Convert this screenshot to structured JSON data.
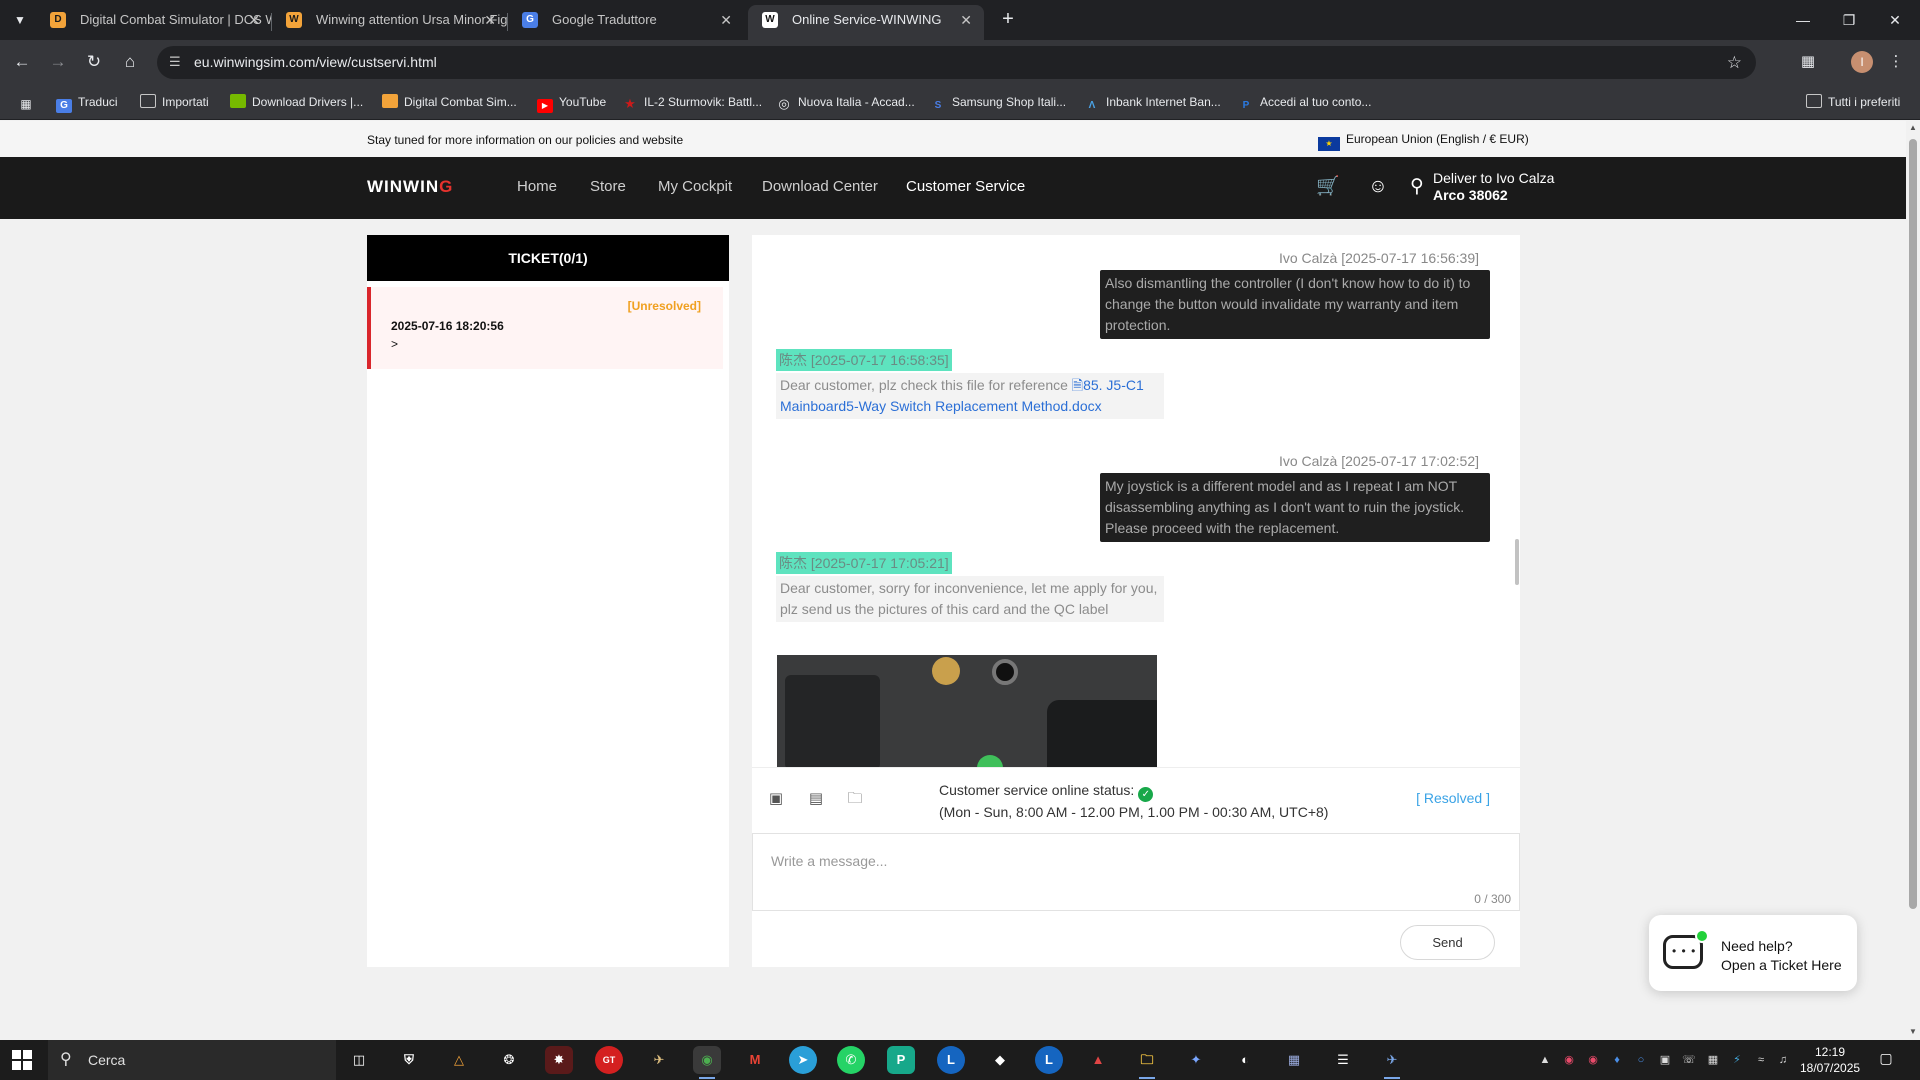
{
  "browser": {
    "tabs": [
      {
        "title": "Digital Combat Simulator | DCS World",
        "favicon": "DCS",
        "fav_color": "#f2a33a"
      },
      {
        "title": "Winwing attention Ursa Minor Fighter",
        "favicon": "W",
        "fav_color": "#f2a33a"
      },
      {
        "title": "Google Traduttore",
        "favicon": "G",
        "fav_color": "#4a7ee6"
      },
      {
        "title": "Online Service-WINWING",
        "favicon": "W",
        "fav_color": "#ffffff"
      }
    ],
    "url": "eu.winwingsim.com/view/custservi.html",
    "bookmarks": [
      {
        "label": "Traduci",
        "icon": "translate-icon",
        "color": "#4a7ee6"
      },
      {
        "label": "Importati",
        "icon": "folder-icon",
        "color": "transparent"
      },
      {
        "label": "Download Drivers |...",
        "icon": "nvidia-icon",
        "color": "#76b900"
      },
      {
        "label": "Digital Combat Sim...",
        "icon": "dcs-icon",
        "color": "#f2a33a"
      },
      {
        "label": "YouTube",
        "icon": "youtube-icon",
        "color": "#ff0000"
      },
      {
        "label": "IL-2 Sturmovik: Battl...",
        "icon": "star-icon",
        "color": "#cc1a1a"
      },
      {
        "label": "Nuova Italia - Accad...",
        "icon": "globe-icon",
        "color": "transparent"
      },
      {
        "label": "Samsung Shop Itali...",
        "icon": "samsung-icon",
        "color": "transparent"
      },
      {
        "label": "Inbank Internet Ban...",
        "icon": "bank-icon",
        "color": "transparent"
      },
      {
        "label": "Accedi al tuo conto...",
        "icon": "paypal-icon",
        "color": "transparent"
      }
    ],
    "all_bookmarks": "Tutti i preferiti"
  },
  "site": {
    "notice": "Stay tuned for more information on our policies and website",
    "region": "European Union (English / € EUR)",
    "logo_main": "WINWIN",
    "logo_accent": "G",
    "nav": [
      "Home",
      "Store",
      "My Cockpit",
      "Download Center",
      "Customer Service"
    ],
    "deliver_line1": "Deliver to Ivo Calza",
    "deliver_line2": "Arco 38062",
    "accent_color": "#e6322d"
  },
  "tickets": {
    "header": "TICKET(0/1)",
    "items": [
      {
        "status": "[Unresolved]",
        "datetime": "2025-07-16 18:20:56",
        "arrow": ">"
      }
    ]
  },
  "chat": {
    "messages": [
      {
        "from": "user",
        "meta": "Ivo Calzà [2025-07-17 16:56:39]",
        "text": "Also dismantling the controller (I don't know how to do it) to change the button would invalidate my warranty and item protection."
      },
      {
        "from": "agent",
        "meta": "陈杰 [2025-07-17 16:58:35]",
        "text": "Dear customer, plz check this file for reference ",
        "link": "85. J5-C1 Mainboard5-Way Switch Replacement Method.docx"
      },
      {
        "from": "user",
        "meta": "Ivo Calzà [2025-07-17 17:02:52]",
        "text": "My joystick is a different model and as I repeat I am NOT disassembling anything as I don't want to ruin the joystick. Please proceed with the replacement."
      },
      {
        "from": "agent",
        "meta": "陈杰 [2025-07-17 17:05:21]",
        "text": "Dear customer, sorry for inconvenience, let me apply for you, plz send us the pictures of this card and the QC label"
      }
    ],
    "status_label": "Customer service online status:",
    "status_hours": "(Mon - Sun, 8:00 AM - 12.00 PM, 1.00 PM - 00:30 AM, UTC+8)",
    "resolved_label": "[ Resolved ]",
    "input_placeholder": "Write a message...",
    "char_count": "0 / 300",
    "send_label": "Send"
  },
  "help": {
    "line1": "Need help?",
    "line2": "Open a Ticket Here"
  },
  "taskbar": {
    "search_label": "Cerca",
    "time": "12:19",
    "date": "18/07/2025"
  }
}
